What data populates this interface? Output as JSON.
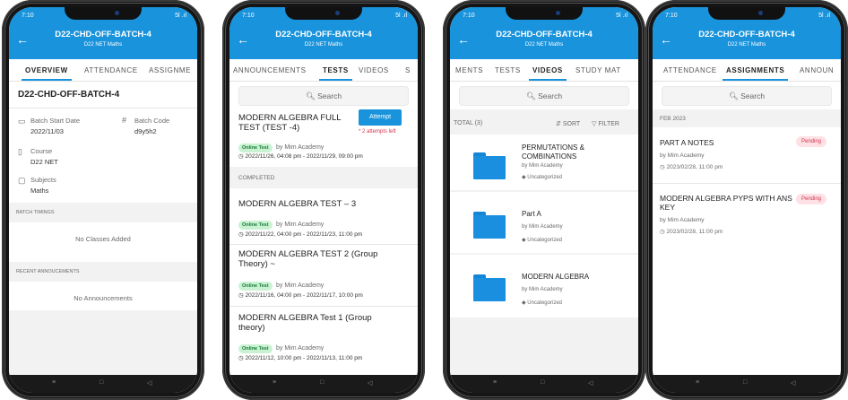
{
  "status_time": "7:10",
  "status_signal": "5l .ıl",
  "batch_title": "D22-CHD-OFF-BATCH-4",
  "batch_sub": "D22 NET   Maths",
  "nav_keys": [
    "≡",
    "□",
    "◁"
  ],
  "screen1": {
    "tabs": [
      "OVERVIEW",
      "ATTENDANCE",
      "ASSIGNME"
    ],
    "heading": "D22-CHD-OFF-BATCH-4",
    "start_label": "Batch Start Date",
    "start_value": "2022/11/03",
    "code_label": "Batch Code",
    "code_value": "d9y5h2",
    "course_label": "Course",
    "course_value": "D22 NET",
    "subjects_label": "Subjects",
    "subjects_value": "Maths",
    "timings_header": "BATCH TIMINGS",
    "timings_empty": "No Classes Added",
    "ann_header": "RECENT ANNOUCEMENTS",
    "ann_empty": "No Announcements"
  },
  "screen2": {
    "tabs": [
      "ANNOUNCEMENTS",
      "TESTS",
      "VIDEOS",
      "S"
    ],
    "search_placeholder": "Search",
    "upcoming": {
      "title": "MODERN ALGEBRA FULL TEST (TEST -4)",
      "pill": "Online Test",
      "by": "by Mim Academy",
      "time": "2022/11/26, 04:08 pm - 2022/11/29, 09:00 pm",
      "attempt": "Attempt",
      "attempts_left": "* 2 attempts left"
    },
    "completed_header": "COMPLETED",
    "completed": [
      {
        "title": "MODERN ALGEBRA TEST – 3",
        "pill": "Online Test",
        "by": "by Mim Academy",
        "time": "2022/11/22, 04:00 pm - 2022/11/23, 11:00 pm"
      },
      {
        "title": "MODERN ALGEBRA TEST 2 (Group Theory) ~",
        "pill": "Online Test",
        "by": "by Mim Academy",
        "time": "2022/11/16, 04:00 pm - 2022/11/17, 10:00 pm"
      },
      {
        "title": "MODERN ALGEBRA Test 1 (Group theory)",
        "pill": "Online Test",
        "by": "by Mim Academy",
        "time": "2022/11/12, 10:00 pm - 2022/11/13, 11:00 pm"
      }
    ]
  },
  "screen3": {
    "tabs": [
      "MENTS",
      "TESTS",
      "VIDEOS",
      "STUDY MAT"
    ],
    "search_placeholder": "Search",
    "total": "TOTAL (3)",
    "sort": "SORT",
    "filter": "FILTER",
    "folders": [
      {
        "name": "PERMUTATIONS & COMBINATIONS",
        "by": "by Mim Academy",
        "tag": "Uncategorized"
      },
      {
        "name": "Part A",
        "by": "by Mim Academy",
        "tag": "Uncategorized"
      },
      {
        "name": "MODERN ALGEBRA",
        "by": "by Mim Academy",
        "tag": "Uncategorized"
      }
    ]
  },
  "screen4": {
    "tabs": [
      "ATTENDANCE",
      "ASSIGNMENTS",
      "ANNOUN"
    ],
    "search_placeholder": "Search",
    "month": "FEB 2023",
    "items": [
      {
        "title": "PART A NOTES",
        "by": "by Mim Academy",
        "due": "2023/02/28, 11:00 pm",
        "status": "Pending"
      },
      {
        "title": "MODERN ALGEBRA PYPS WITH ANS KEY",
        "by": "by Mim Academy",
        "due": "2023/02/28, 11:00 pm",
        "status": "Pending"
      }
    ]
  },
  "colors": {
    "primary": "#1893dc",
    "pill_bg": "#c9f2d2",
    "pending": "#d6344f"
  }
}
